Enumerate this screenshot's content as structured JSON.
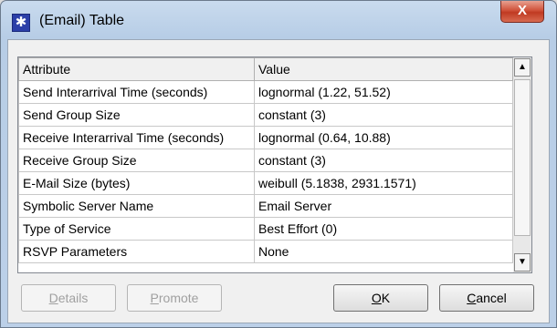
{
  "window": {
    "title": "(Email) Table",
    "close_glyph": "X"
  },
  "table": {
    "headers": [
      "Attribute",
      "Value"
    ],
    "rows": [
      [
        "Send Interarrival Time (seconds)",
        "lognormal (1.22, 51.52)"
      ],
      [
        "Send Group Size",
        "constant (3)"
      ],
      [
        "Receive Interarrival Time (seconds)",
        "lognormal (0.64, 10.88)"
      ],
      [
        "Receive Group Size",
        "constant (3)"
      ],
      [
        "E-Mail Size (bytes)",
        "weibull (5.1838, 2931.1571)"
      ],
      [
        "Symbolic Server Name",
        "Email Server"
      ],
      [
        "Type of Service",
        "Best Effort (0)"
      ],
      [
        "RSVP Parameters",
        "None"
      ]
    ]
  },
  "buttons": {
    "details": {
      "first": "D",
      "rest": "etails"
    },
    "promote": {
      "first": "P",
      "rest": "romote"
    },
    "ok": {
      "first": "O",
      "rest": "K"
    },
    "cancel": {
      "first": "C",
      "rest": "ancel"
    }
  },
  "icons": {
    "app": "star-app-icon",
    "close": "close-icon",
    "up": "arrow-up-icon",
    "down": "arrow-down-icon"
  }
}
